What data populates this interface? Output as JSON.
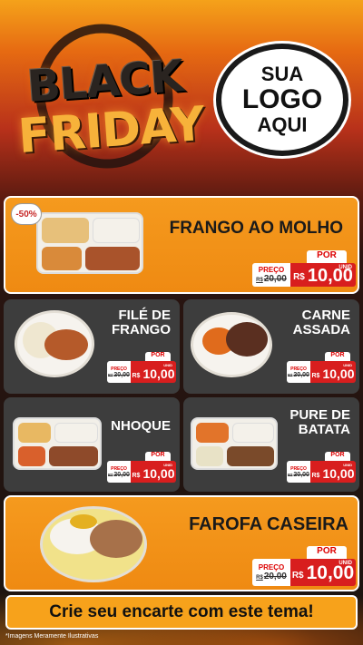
{
  "header": {
    "black_text": "BLACK",
    "friday_text": "FRIDAY",
    "logo_line1": "SUA",
    "logo_line2": "LOGO",
    "logo_line3": "AQUI"
  },
  "items": [
    {
      "name": "FRANGO AO MOLHO",
      "discount": "-50%",
      "por": "POR",
      "preco_label": "PREÇO",
      "old_price": "20,00",
      "old_prefix": "R$",
      "currency": "R$",
      "new_price": "10,00",
      "unit": "UNID"
    },
    {
      "name_l1": "FILÉ DE",
      "name_l2": "FRANGO",
      "por": "POR",
      "preco_label": "PREÇO",
      "old_price": "20,00",
      "old_prefix": "R$",
      "currency": "R$",
      "new_price": "10,00",
      "unit": "UNID"
    },
    {
      "name_l1": "CARNE",
      "name_l2": "ASSADA",
      "por": "POR",
      "preco_label": "PREÇO",
      "old_price": "20,00",
      "old_prefix": "R$",
      "currency": "R$",
      "new_price": "10,00",
      "unit": "UNID"
    },
    {
      "name": "NHOQUE",
      "por": "POR",
      "preco_label": "PREÇO",
      "old_price": "20,00",
      "old_prefix": "R$",
      "currency": "R$",
      "new_price": "10,00",
      "unit": "UNID"
    },
    {
      "name_l1": "PURE DE",
      "name_l2": "BATATA",
      "por": "POR",
      "preco_label": "PREÇO",
      "old_price": "20,00",
      "old_prefix": "R$",
      "currency": "R$",
      "new_price": "10,00",
      "unit": "UNID"
    },
    {
      "name": "FAROFA CASEIRA",
      "por": "POR",
      "preco_label": "PREÇO",
      "old_price": "20,00",
      "old_prefix": "R$",
      "currency": "R$",
      "new_price": "10,00",
      "unit": "UNID"
    }
  ],
  "cta": "Crie seu encarte com este tema!",
  "note": "*Imagens Meramente Ilustrativas",
  "colors": {
    "orange": "#f59a1e",
    "dark_card": "#3d3d3d",
    "price_red": "#d81e1e"
  }
}
